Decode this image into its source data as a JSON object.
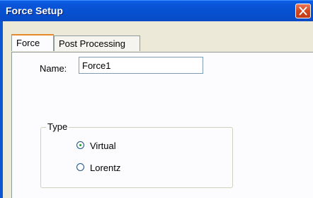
{
  "window": {
    "title": "Force Setup"
  },
  "tabs": [
    {
      "label": "Force",
      "active": true
    },
    {
      "label": "Post Processing",
      "active": false
    }
  ],
  "name_field": {
    "label": "Name:",
    "value": "Force1"
  },
  "type_group": {
    "legend": "Type",
    "options": [
      {
        "label": "Virtual",
        "selected": true
      },
      {
        "label": "Lorentz",
        "selected": false
      }
    ]
  },
  "colors": {
    "titlebar": "#0a55d8",
    "close_button": "#d4451f",
    "dialog_background": "#ece9d8",
    "active_tab_accent": "#e68b2c"
  }
}
